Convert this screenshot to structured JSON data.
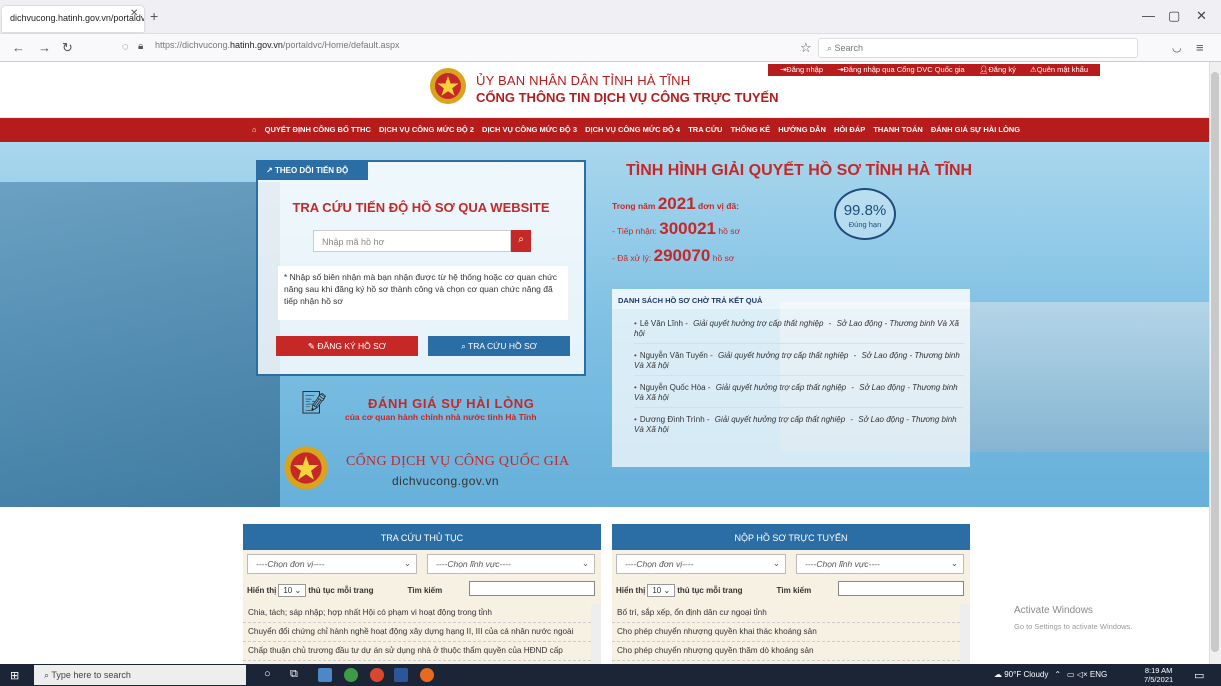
{
  "browser": {
    "tab_title": "dichvucong.hatinh.gov.vn/portaldvc",
    "url_pre": "https://dichvucong.",
    "url_host": "hatinh.gov.vn",
    "url_post": "/portaldvc/Home/default.aspx",
    "search_placeholder": "Search"
  },
  "header": {
    "org": "ỦY BAN NHÂN DÂN TỈNH HÀ TĨNH",
    "portal": "CỔNG THÔNG TIN DỊCH VỤ CÔNG TRỰC TUYẾN",
    "links": [
      "Đăng nhập",
      "Đăng nhập qua Cổng DVC Quốc gia",
      "Đăng ký",
      "Quên mật khẩu"
    ]
  },
  "menu": [
    "QUYẾT ĐỊNH CÔNG BỐ TTHC",
    "DỊCH VỤ CÔNG MỨC ĐỘ 2",
    "DỊCH VỤ CÔNG MỨC ĐỘ 3",
    "DỊCH VỤ CÔNG MỨC ĐỘ 4",
    "TRA CỨU",
    "THỐNG KÊ",
    "HƯỚNG DẪN",
    "HỎI ĐÁP",
    "THANH TOÁN",
    "ĐÁNH GIÁ SỰ HÀI LÒNG"
  ],
  "track": {
    "tab": "THEO DÕI TIẾN ĐỘ",
    "title": "TRA CỨU TIẾN ĐỘ HỒ SƠ QUA WEBSITE",
    "placeholder": "Nhập mã hồ hơ",
    "note": "* Nhập số biên nhận mà bạn nhận được từ hệ thống hoặc cơ quan chức năng sau khi đăng ký hồ sơ thành công và chọn cơ quan chức năng đã tiếp nhận hồ sơ",
    "btn_register": "ĐĂNG KÝ HỒ SƠ",
    "btn_lookup": "TRA CỨU HỒ SƠ"
  },
  "rating": {
    "title": "ĐÁNH GIÁ SỰ HÀI LÒNG",
    "sub": "của cơ quan hành chính nhà nước tỉnh Hà Tĩnh"
  },
  "national": {
    "title": "CỔNG DỊCH VỤ CÔNG QUỐC GIA",
    "url": "dichvucong.gov.vn"
  },
  "status": {
    "title": "TÌNH HÌNH GIẢI QUYẾT HỒ SƠ TỈNH HÀ TĨNH",
    "year_pre": "Trong năm",
    "year": "2021",
    "year_post": "đơn vị đã:",
    "recv_label": "- Tiếp nhận:",
    "recv": "300021",
    "recv_unit": "hồ sơ",
    "done_label": "- Đã xử lý:",
    "done": "290070",
    "done_unit": "hồ sơ",
    "pct": "99.8%",
    "pct_label": "Đúng hạn"
  },
  "pending": {
    "title": "DANH SÁCH HỒ SƠ CHỜ TRẢ KẾT QUẢ",
    "items": [
      {
        "name": "Lê Văn Lĩnh",
        "case": "Giải quyết hưởng trợ cấp thất nghiệp",
        "agency": "Sở Lao động - Thương binh Và Xã hội"
      },
      {
        "name": "Nguyễn Văn Tuyến",
        "case": "Giải quyết hưởng trợ cấp thất nghiệp",
        "agency": "Sở Lao động - Thương binh Và Xã hội"
      },
      {
        "name": "Nguyễn Quốc Hòa",
        "case": "Giải quyết hưởng trợ cấp thất nghiệp",
        "agency": "Sở Lao động - Thương binh Và Xã hội"
      },
      {
        "name": "Dương Đình Trình",
        "case": "Giải quyết hưởng trợ cấp thất nghiệp",
        "agency": "Sở Lao động - Thương binh Và Xã hội"
      }
    ]
  },
  "lookup": {
    "title": "TRA CỨU THỦ TỤC",
    "unit": "----Chọn đơn vị----",
    "field": "----Chọn lĩnh vực----",
    "show": "Hiển thị",
    "count": "10",
    "per_page": "thủ tục mỗi trang",
    "search": "Tìm kiếm",
    "rows": [
      "Chia, tách; sáp nhập; hợp nhất Hội có phạm vi hoạt động trong tỉnh",
      "Chuyển đổi chứng chỉ hành nghề hoạt động xây dựng hạng II, III của cá nhân nước ngoài",
      "Chấp thuận chủ trương đầu tư dự án sử dụng nhà ở thuộc thẩm quyền của HĐND cấp"
    ]
  },
  "submit": {
    "title": "NỘP HỒ SƠ TRỰC TUYẾN",
    "unit": "----Chọn đơn vị----",
    "field": "----Chọn lĩnh vực----",
    "show": "Hiển thị",
    "count": "10",
    "per_page": "thủ tục mỗi trang",
    "search": "Tìm kiếm",
    "rows": [
      "Bố trí, sắp xếp, ổn định dân cư ngoại tỉnh",
      "Cho phép chuyển nhượng quyền khai thác khoáng sản",
      "Cho phép chuyển nhượng quyền thăm dò khoáng sản"
    ]
  },
  "windows": {
    "activate": "Activate Windows",
    "activate_sub": "Go to Settings to activate Windows.",
    "search": "Type here to search",
    "weather": "90°F Cloudy",
    "lang": "ENG",
    "time": "8:19 AM",
    "date": "7/5/2021"
  },
  "colors": {
    "brand_red": "#b71c1c",
    "brand_blue": "#2b6ea5"
  }
}
